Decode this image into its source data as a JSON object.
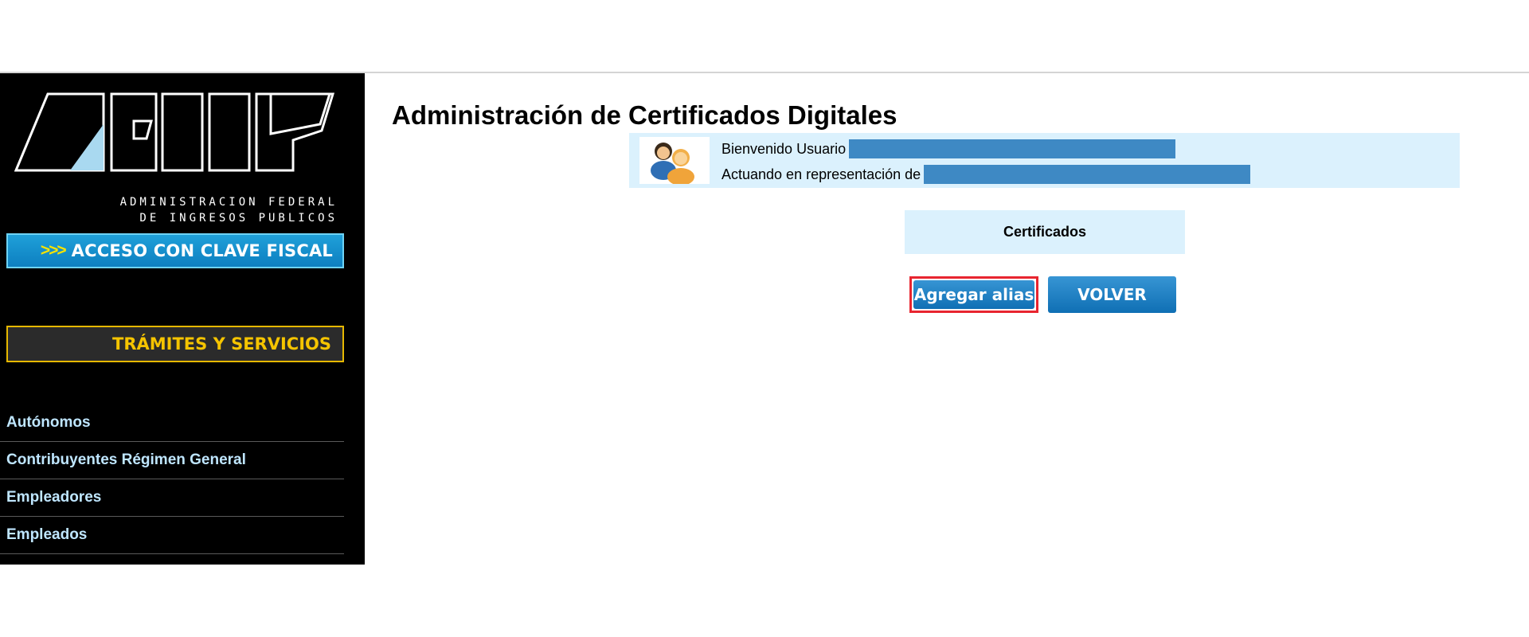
{
  "logo": {
    "line1": "ADMINISTRACION FEDERAL",
    "line2": "DE INGRESOS PUBLICOS"
  },
  "sidebar": {
    "clave_chevrons": ">>>",
    "clave_label": "ACCESO CON CLAVE FISCAL",
    "tramites_label": "TRÁMITES Y SERVICIOS",
    "links": [
      "Autónomos",
      "Contribuyentes Régimen General",
      "Empleadores",
      "Empleados"
    ]
  },
  "main": {
    "title": "Administración de Certificados Digitales",
    "welcome_prefix": "Bienvenido Usuario",
    "acting_prefix": "Actuando en representación de",
    "cert_header": "Certificados",
    "alias_button": "Agregar alias",
    "back_button": "VOLVER"
  },
  "colors": {
    "sidebar_bg": "#000000",
    "clave_blue": "#1fa0d9",
    "tramites_gold": "#f5c400",
    "panel_light_blue": "#dbf1fd",
    "button_blue": "#1f7fc4",
    "highlight_red": "#e8252f",
    "redaction_blue": "#3e89c4"
  }
}
